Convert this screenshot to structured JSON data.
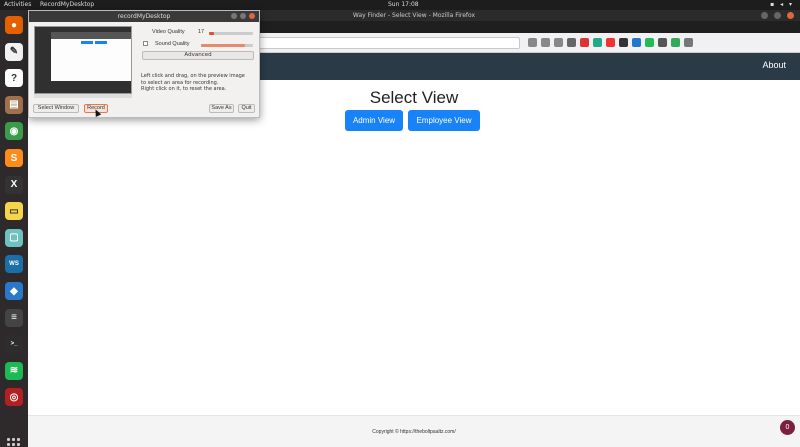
{
  "topbar": {
    "activities": "Activities",
    "app_menu": "RecordMyDesktop",
    "clock": "Sun 17:08"
  },
  "firefox": {
    "window_title": "Way Finder - Select View - Mozilla Firefox"
  },
  "page": {
    "nav_about": "About",
    "title": "Select View",
    "admin_button": "Admin View",
    "employee_button": "Employee View",
    "footer_text": "Copyright © https://theboltpaaltz.com/",
    "badge": "0"
  },
  "recorder": {
    "title": "recordMyDesktop",
    "video_quality_label": "Video Quality",
    "video_quality_value": "17",
    "video_quality_level": 0.12,
    "sound_quality_label": "Sound Quality",
    "sound_quality_level": 0.85,
    "advanced_label": "Advanced",
    "help_text_1": "Left click and drag, on the preview image",
    "help_text_2": "to select an area for recording.",
    "help_text_3": "Right click on it, to reset the area.",
    "select_window_label": "Select Window",
    "record_label": "Record",
    "save_as_label": "Save As",
    "quit_label": "Quit"
  },
  "dock": [
    {
      "icon": "firefox-icon",
      "color": "#e66000"
    },
    {
      "icon": "text-editor-icon",
      "color": "#f2f2f2"
    },
    {
      "icon": "help-icon",
      "color": "#ffffff"
    },
    {
      "icon": "files-icon",
      "color": "#a1704c"
    },
    {
      "icon": "chrome-icon",
      "color": "#3a9b4b"
    },
    {
      "icon": "sublime-icon",
      "color": "#ff8b1a"
    },
    {
      "icon": "xampp-icon",
      "color": "#333333"
    },
    {
      "icon": "notes-icon",
      "color": "#f6d54a"
    },
    {
      "icon": "remmina-icon",
      "color": "#6ec3c0"
    },
    {
      "icon": "webstorm-icon",
      "color": "#1b6fa8"
    },
    {
      "icon": "vscode-icon",
      "color": "#2a78c9"
    },
    {
      "icon": "record-icon",
      "color": "#444444"
    },
    {
      "icon": "terminal-icon",
      "color": "#2d2d2d"
    },
    {
      "icon": "spotify-icon",
      "color": "#1db954"
    },
    {
      "icon": "screenrecorder-icon",
      "color": "#b32020"
    }
  ]
}
